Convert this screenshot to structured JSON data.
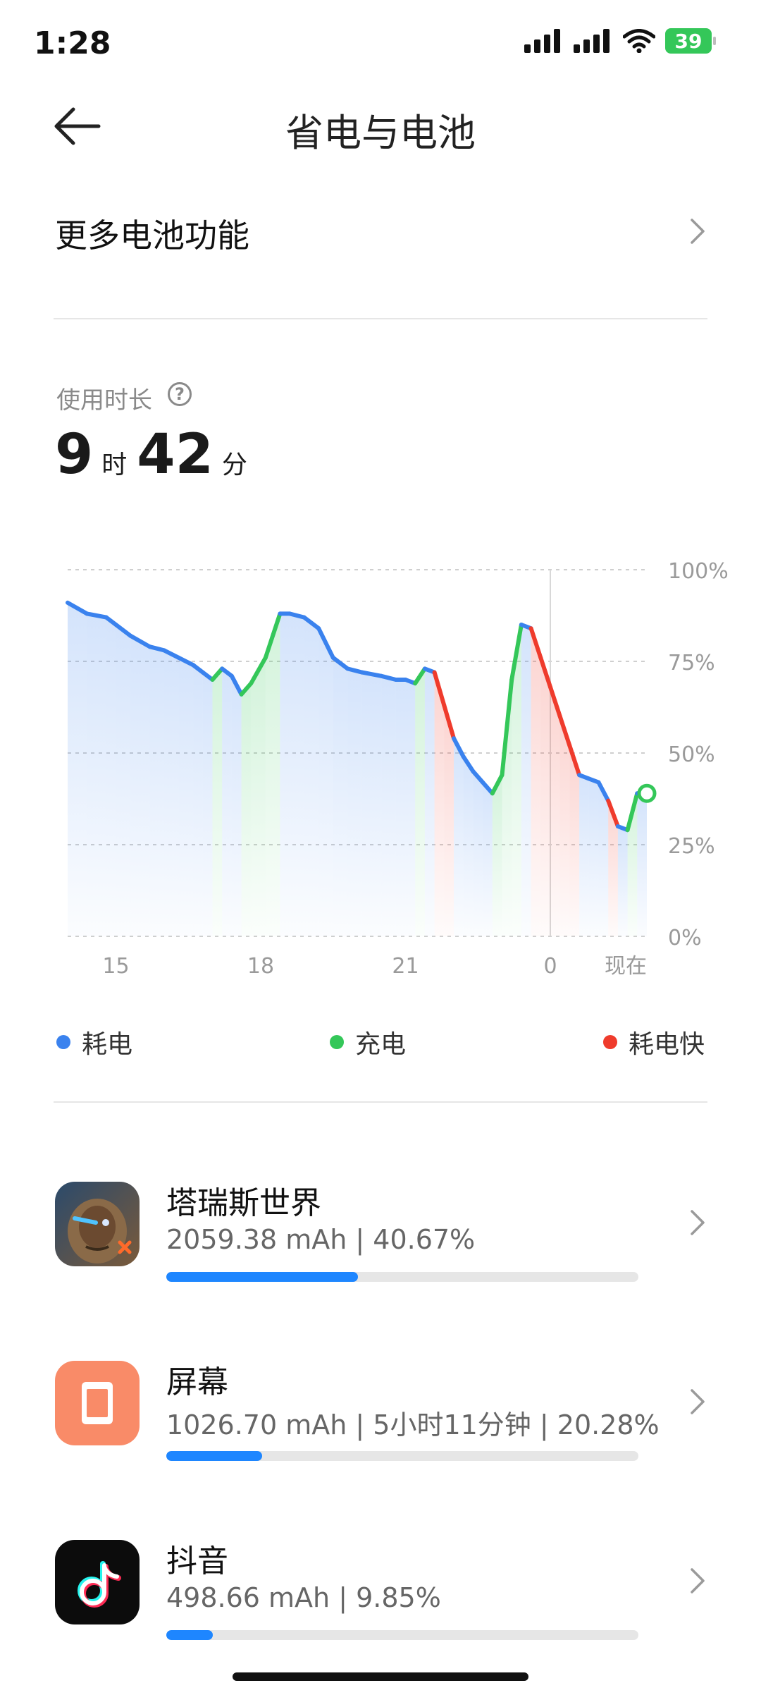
{
  "status_bar": {
    "time": "1:28",
    "battery_level": "39"
  },
  "header": {
    "title": "省电与电池"
  },
  "more_features": {
    "label": "更多电池功能"
  },
  "usage": {
    "label": "使用时长",
    "hours": "9",
    "hours_unit": "时",
    "minutes": "42",
    "minutes_unit": "分"
  },
  "chart_data": {
    "type": "line",
    "y_ticks": [
      "100%",
      "75%",
      "50%",
      "25%",
      "0%"
    ],
    "ylim": [
      0,
      100
    ],
    "x_ticks": [
      "15",
      "18",
      "21",
      "0",
      "现在"
    ],
    "x": [
      14.0,
      14.4,
      14.8,
      15.0,
      15.3,
      15.7,
      16.0,
      16.3,
      16.6,
      16.8,
      17.0,
      17.2,
      17.4,
      17.6,
      17.8,
      18.1,
      18.4,
      18.6,
      18.9,
      19.2,
      19.5,
      19.8,
      20.1,
      20.5,
      20.8,
      21.0,
      21.2,
      21.4,
      21.6,
      21.8,
      22.0,
      22.2,
      22.4,
      22.6,
      22.8,
      23.0,
      23.2,
      23.4,
      23.6,
      23.8,
      24.0,
      24.2,
      24.4,
      24.6,
      24.8,
      25.0,
      25.2,
      25.4,
      25.6,
      25.8,
      26.0
    ],
    "series": [
      {
        "name": "耗电",
        "color": "#3a82ee",
        "values": [
          91,
          88,
          87,
          85,
          82,
          79,
          78,
          76,
          74,
          72,
          70,
          73,
          71,
          66,
          69,
          76,
          88,
          88,
          87,
          84,
          76,
          73,
          72,
          71,
          70,
          70,
          69,
          73,
          72,
          63,
          54,
          49,
          45,
          42,
          39,
          44,
          70,
          85,
          84,
          76,
          68,
          60,
          52,
          44,
          43,
          42,
          37,
          30,
          29,
          39,
          39
        ]
      },
      {
        "name": "充电",
        "color": "#34c759"
      },
      {
        "name": "耗电快",
        "color": "#ef3b2c"
      }
    ],
    "grid": true
  },
  "legend": [
    {
      "label": "耗电",
      "color": "#3a82ee"
    },
    {
      "label": "充电",
      "color": "#34c759"
    },
    {
      "label": "耗电快",
      "color": "#ef3b2c"
    }
  ],
  "apps": [
    {
      "name": "塔瑞斯世界",
      "stats": "2059.38 mAh | 40.67%",
      "percent": 40.67,
      "icon": "game-avatar-icon"
    },
    {
      "name": "屏幕",
      "stats": "1026.70 mAh | 5小时11分钟 | 20.28%",
      "percent": 20.28,
      "icon": "screen-icon"
    },
    {
      "name": "抖音",
      "stats": "498.66 mAh | 9.85%",
      "percent": 9.85,
      "icon": "douyin-icon"
    }
  ]
}
